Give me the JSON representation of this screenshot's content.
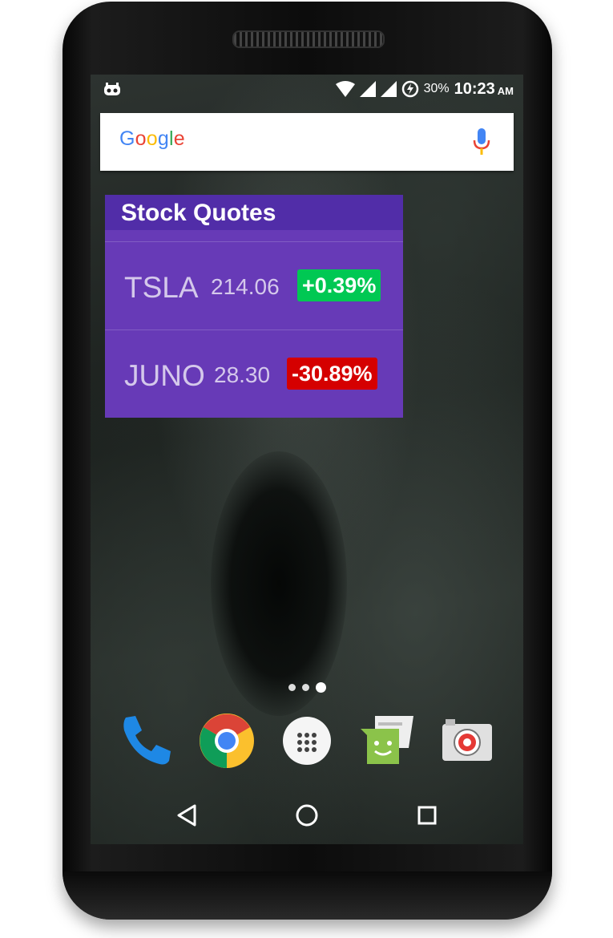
{
  "status_bar": {
    "battery_percent": "30%",
    "time": "10:23",
    "ampm": "AM",
    "icons": [
      "cyanogenmod-icon",
      "wifi-icon",
      "signal-icon",
      "signal-icon",
      "battery-charging-icon"
    ]
  },
  "search_bar": {
    "logo_letters": [
      {
        "char": "G",
        "color": "#4285F4"
      },
      {
        "char": "o",
        "color": "#EA4335"
      },
      {
        "char": "o",
        "color": "#FBBC05"
      },
      {
        "char": "g",
        "color": "#4285F4"
      },
      {
        "char": "l",
        "color": "#34A853"
      },
      {
        "char": "e",
        "color": "#EA4335"
      }
    ],
    "icon": "microphone-icon"
  },
  "widget": {
    "title": "Stock Quotes",
    "colors": {
      "header": "#512da8",
      "body": "#673ab7",
      "positive": "#00c853",
      "negative": "#d50000"
    },
    "quotes": [
      {
        "symbol": "TSLA",
        "price": "214.06",
        "change": "+0.39%",
        "direction": "up"
      },
      {
        "symbol": "JUNO",
        "price": "28.30",
        "change": "-30.89%",
        "direction": "down"
      }
    ]
  },
  "home": {
    "page_count": 3,
    "active_page": 3,
    "dock": [
      "phone-icon",
      "chrome-icon",
      "app-drawer-icon",
      "messenger-icon",
      "camera-icon"
    ]
  },
  "nav_bar": {
    "icons": [
      "back-icon",
      "home-icon",
      "recents-icon"
    ]
  }
}
